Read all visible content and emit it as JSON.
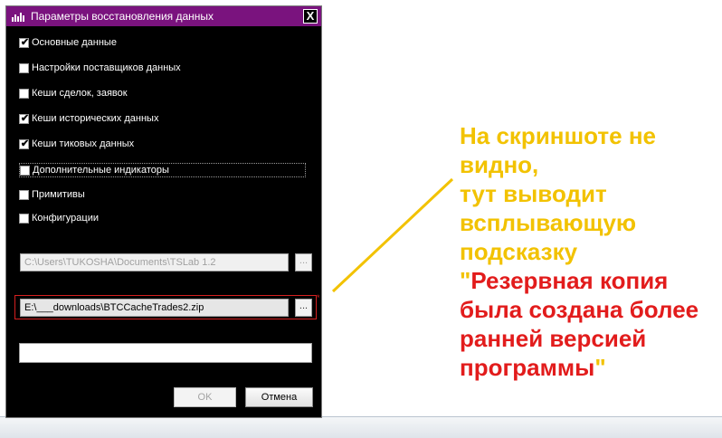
{
  "dialog": {
    "title": "Параметры восстановления данных",
    "close_label": "X",
    "options": [
      {
        "label": "Основные данные",
        "checked": true
      },
      {
        "label": "Настройки поставщиков данных",
        "checked": false
      },
      {
        "label": "Кеши сделок, заявок",
        "checked": false
      },
      {
        "label": "Кеши исторических данных",
        "checked": true
      },
      {
        "label": "Кеши тиковых данных",
        "checked": true
      },
      {
        "label": "Дополнительные индикаторы",
        "checked": false
      },
      {
        "label": "Примитивы",
        "checked": false
      },
      {
        "label": "Конфигурации",
        "checked": false
      }
    ],
    "check_mark": "✔",
    "target_path": "C:\\Users\\TUKOSHA\\Documents\\TSLab 1.2",
    "backup_path": "E:\\___downloads\\BTCCacheTrades2.zip",
    "browse_label": "...",
    "error_marker": "*",
    "ok_label": "OK",
    "cancel_label": "Отмена"
  },
  "annotation": {
    "line1": "На скриншоте не",
    "line2": "видно,",
    "line3": "тут выводит",
    "line4": "всплывающую",
    "line5": "подсказку",
    "quote_open": "\"",
    "red_line1": "Резервная копия",
    "red_line2": "была создана более",
    "red_line3": "ранней версией",
    "red_line4": "программы",
    "quote_close": "\""
  },
  "colors": {
    "titlebar": "#7a137e",
    "dialog_bg": "#000000",
    "annotation_yellow": "#f2c200",
    "annotation_red": "#e21c1c",
    "error_border": "#d52020"
  }
}
